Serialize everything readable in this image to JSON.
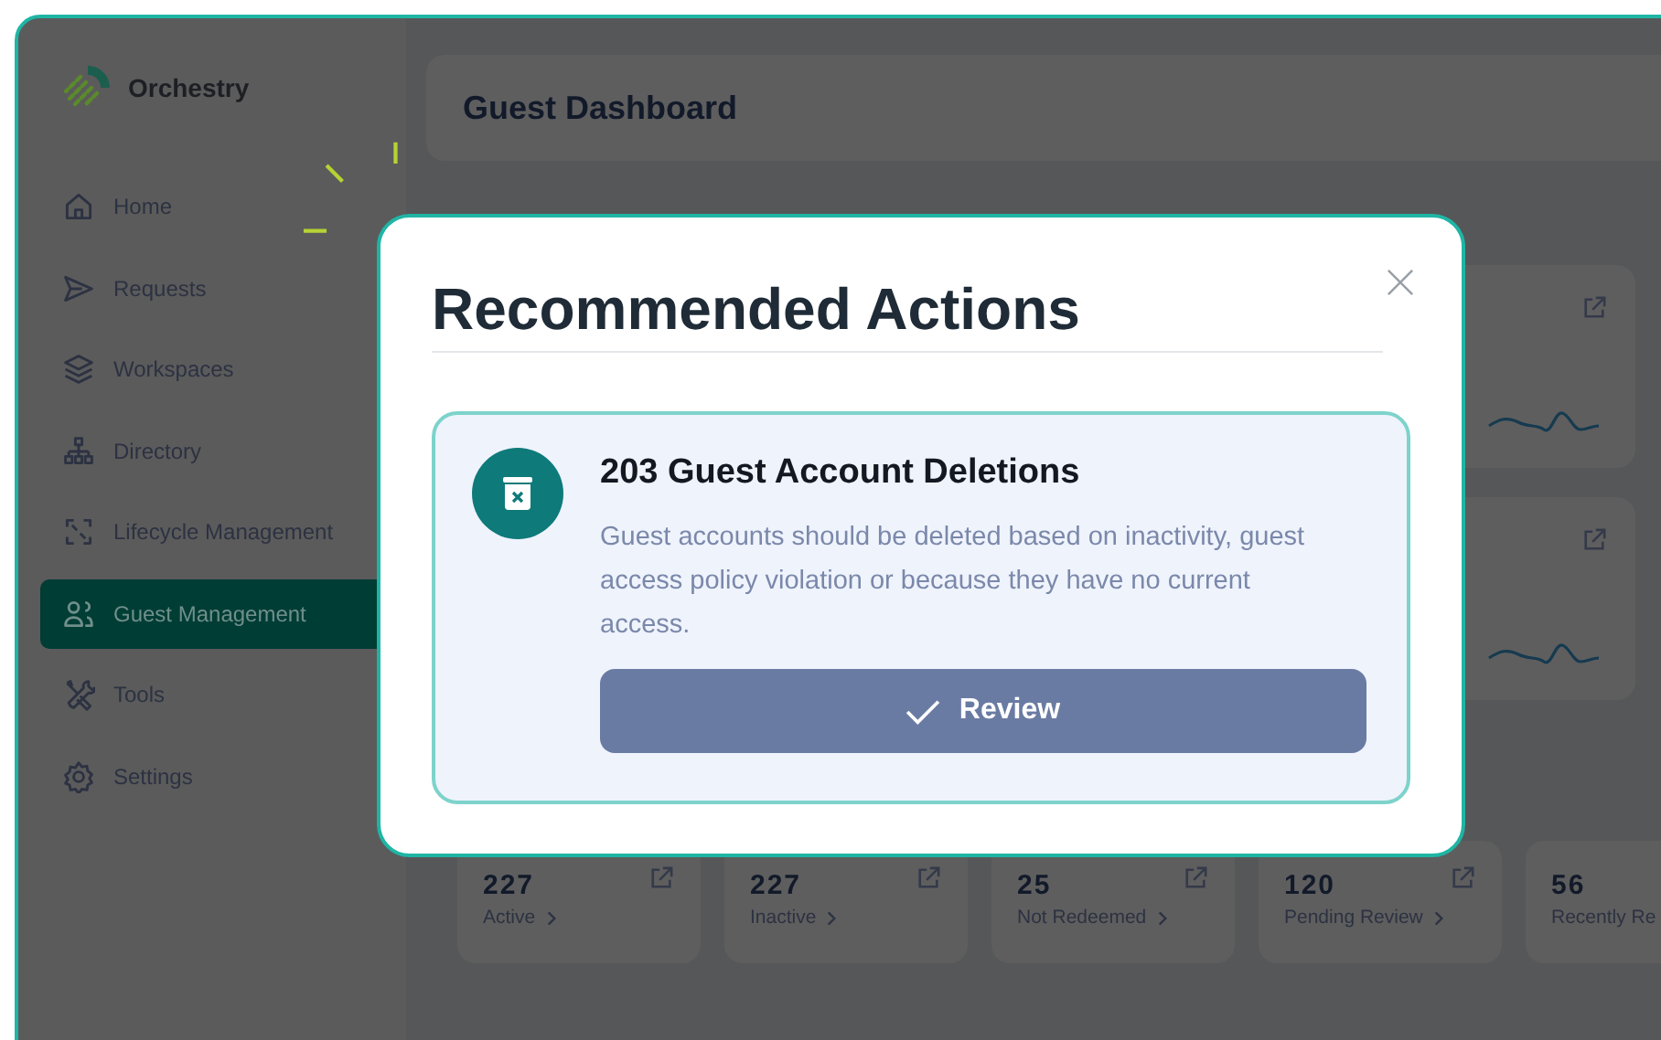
{
  "sidebar": {
    "brand": "Orchestry",
    "items": [
      {
        "label": "Home",
        "selected": false
      },
      {
        "label": "Requests",
        "selected": false
      },
      {
        "label": "Workspaces",
        "selected": false
      },
      {
        "label": "Directory",
        "selected": false
      },
      {
        "label": "Lifecycle Management",
        "selected": false
      },
      {
        "label": "Guest Management",
        "selected": true
      },
      {
        "label": "Tools",
        "selected": false
      },
      {
        "label": "Settings",
        "selected": false
      }
    ]
  },
  "header": {
    "title": "Guest Dashboard"
  },
  "stats": [
    {
      "value": "227",
      "label": "Active"
    },
    {
      "value": "227",
      "label": "Inactive"
    },
    {
      "value": "25",
      "label": "Not Redeemed"
    },
    {
      "value": "120",
      "label": "Pending Review"
    },
    {
      "value": "56",
      "label": "Recently Re"
    }
  ],
  "modal": {
    "title": "Recommended Actions",
    "action": {
      "title": "203 Guest Account Deletions",
      "description": "Guest accounts should be deleted based on inactivity, guest access policy violation or because they have no current access.",
      "button": "Review"
    }
  }
}
